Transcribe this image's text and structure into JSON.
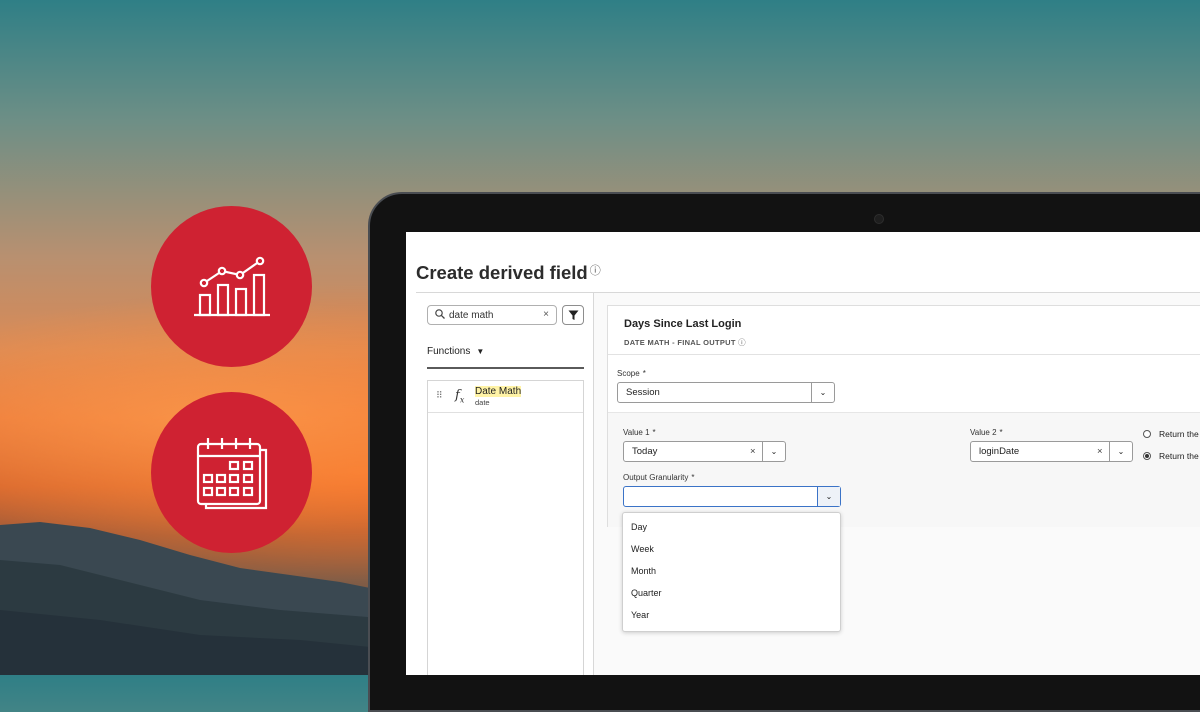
{
  "page": {
    "title": "Create derived field",
    "help_icon": "help-icon"
  },
  "search": {
    "value": "date math",
    "clear_glyph": "×",
    "icon": "search-icon"
  },
  "filter": {
    "icon": "filter-icon"
  },
  "functions_tab": {
    "label": "Functions"
  },
  "function_list": [
    {
      "name_prefix": "Date",
      "name_highlight": " Math",
      "sub": "date",
      "icon": "fx-icon"
    }
  ],
  "card": {
    "title": "Days Since Last Login",
    "subtitle": "DATE MATH - FINAL OUTPUT"
  },
  "scope": {
    "label": "Scope",
    "required": "*",
    "value": "Session"
  },
  "value1": {
    "label": "Value 1",
    "required": "*",
    "value": "Today",
    "clear_glyph": "×"
  },
  "value2": {
    "label": "Value 2",
    "required": "*",
    "value": "loginDate",
    "clear_glyph": "×"
  },
  "radios": [
    {
      "label": "Return the",
      "checked": false
    },
    {
      "label": "Return the",
      "checked": true
    }
  ],
  "granularity": {
    "label": "Output Granularity",
    "required": "*",
    "value": "",
    "options": [
      "Day",
      "Week",
      "Month",
      "Quarter",
      "Year"
    ]
  },
  "marketing_icons": [
    "analytics-chart-icon",
    "calendar-icon"
  ],
  "colors": {
    "accent_red": "#cf2232",
    "screen_bg": "#ffffff",
    "highlight": "#fff3a6"
  }
}
